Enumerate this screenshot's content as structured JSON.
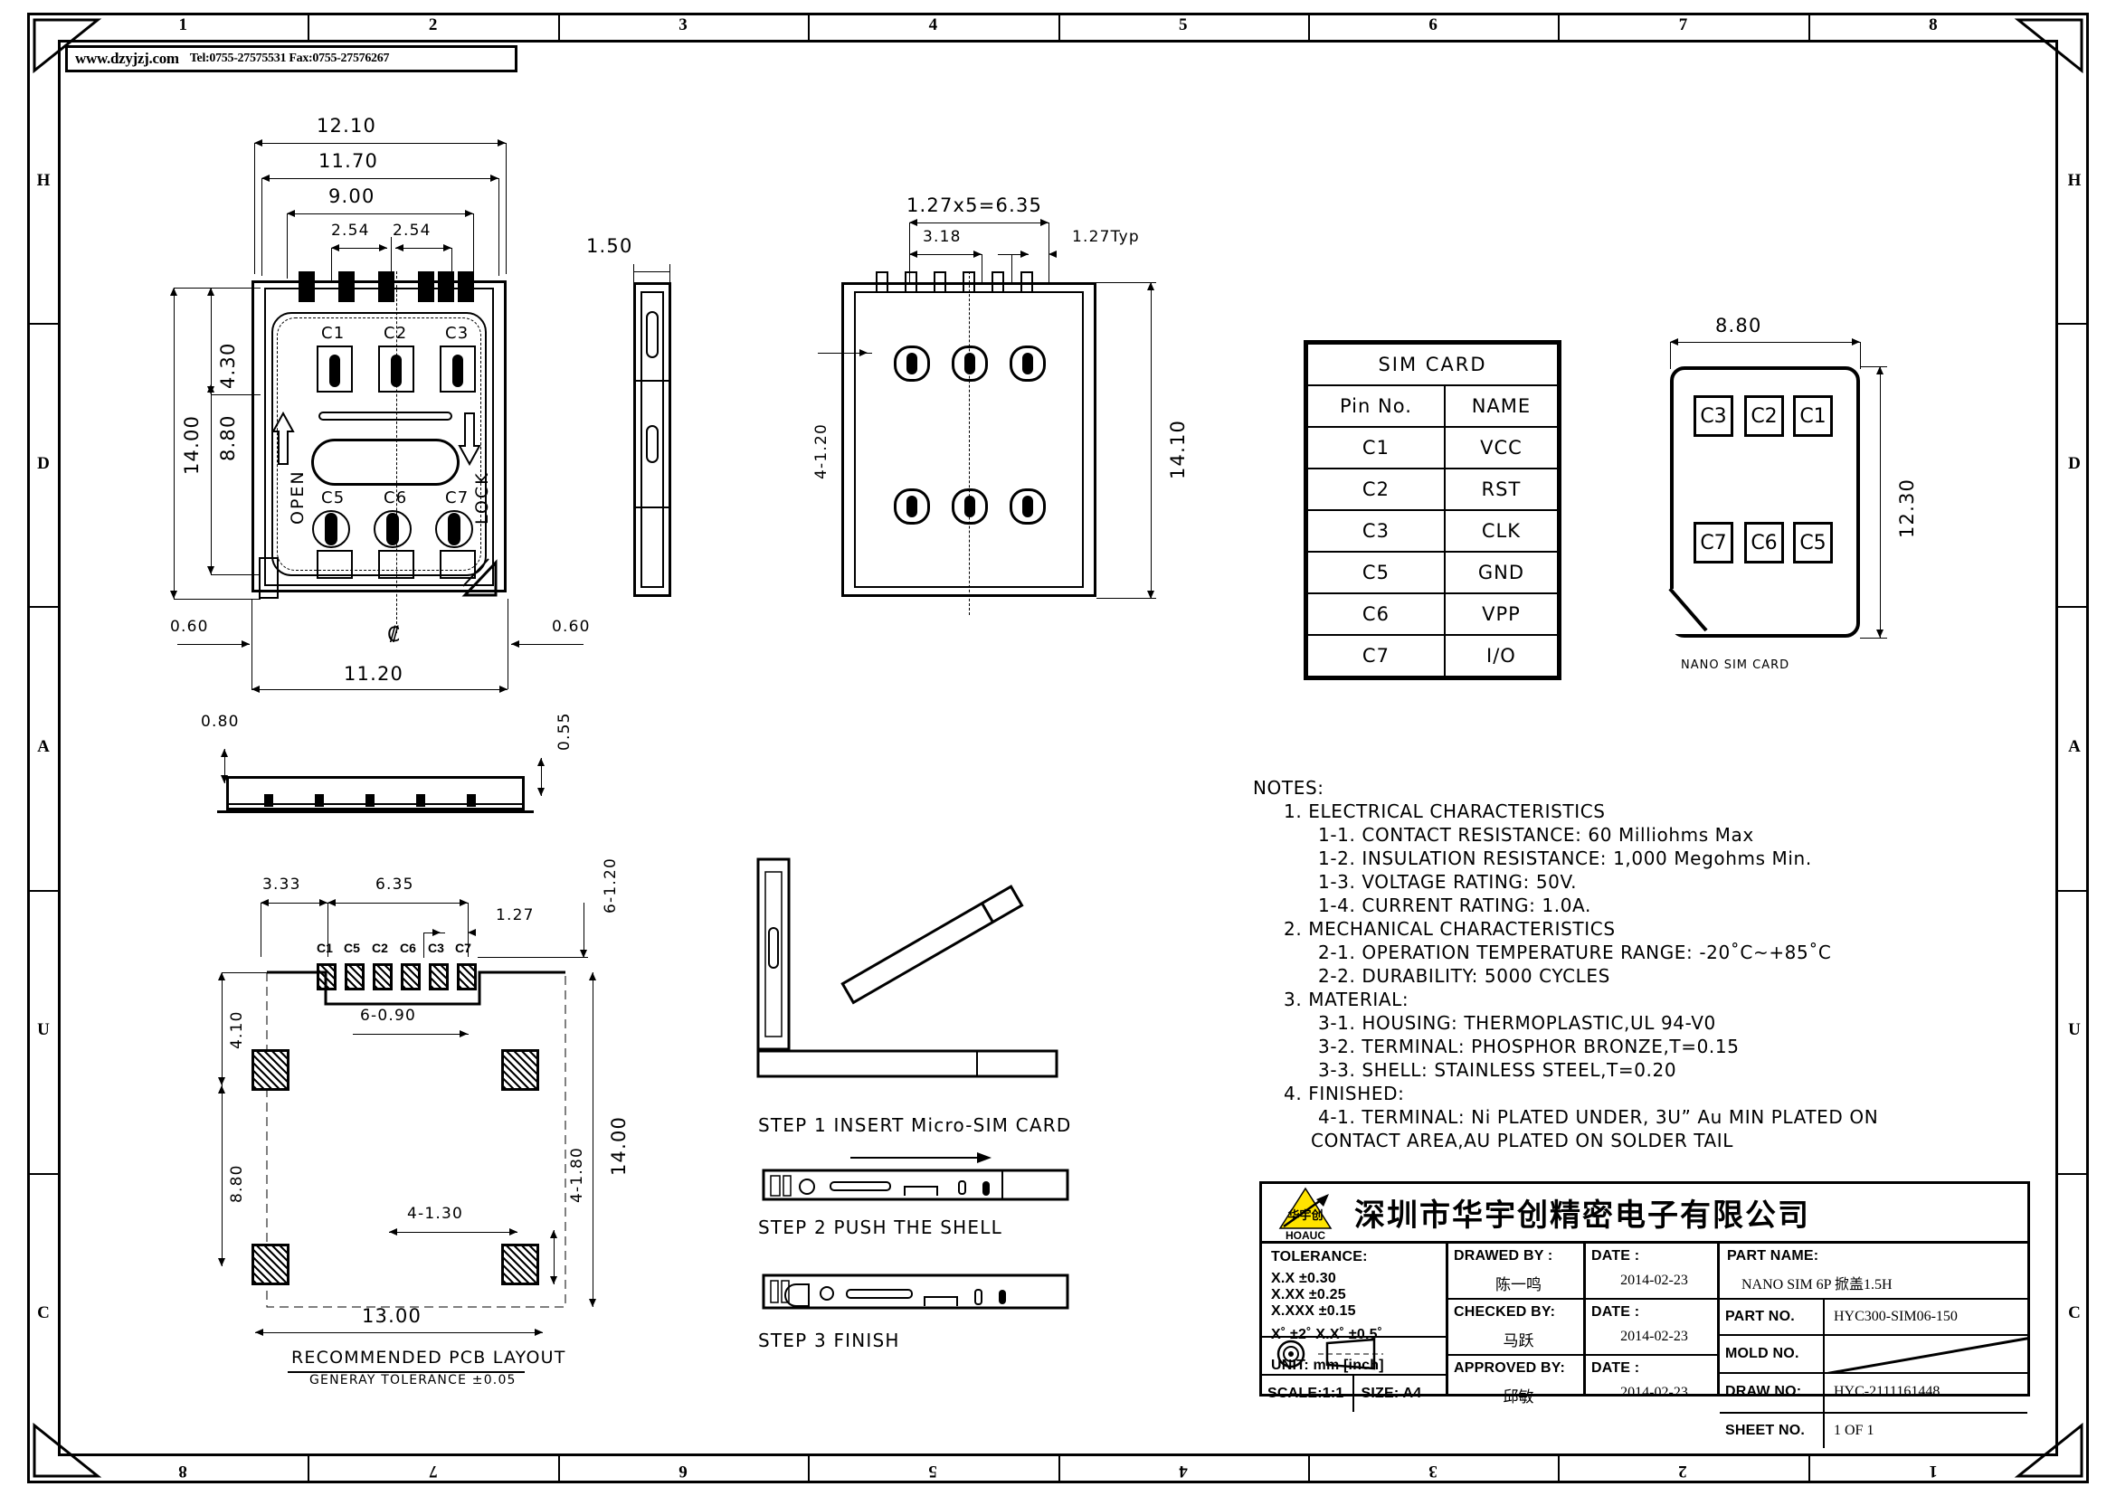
{
  "header": {
    "url": "www.dzyjzj.com",
    "contact": "Tel:0755-27575531  Fax:0755-27576267"
  },
  "zones": {
    "top": [
      "1",
      "2",
      "3",
      "4",
      "5",
      "6",
      "7",
      "8"
    ],
    "bottom": [
      "8",
      "7",
      "6",
      "5",
      "4",
      "3",
      "2",
      "1"
    ],
    "left": [
      "H",
      "D",
      "A",
      "U",
      "C"
    ],
    "right": [
      "H",
      "D",
      "A",
      "U",
      "C"
    ]
  },
  "views": {
    "top_view": {
      "dims": {
        "d1210": "12.10",
        "d1170": "11.70",
        "d900": "9.00",
        "d254a": "2.54",
        "d254b": "2.54",
        "d430": "4.30",
        "d1400": "14.00",
        "d880": "8.80",
        "d060_left": "0.60",
        "d060_right": "0.60",
        "d1120": "11.20"
      },
      "pins_top": [
        "C1",
        "C2",
        "C3"
      ],
      "pins_bottom": [
        "C5",
        "C6",
        "C7"
      ],
      "open_label": "OPEN",
      "lock_label": "LOCK",
      "center_symbol": "₡"
    },
    "side_view": {
      "d150": "1.50"
    },
    "bottom_view": {
      "d127x5": "1.27x5=6.35",
      "d318": "3.18",
      "d127typ": "1.27Typ",
      "d1410": "14.10",
      "d4_120": "4-1.20"
    },
    "front_view": {
      "d080": "0.80",
      "d055": "0.55"
    },
    "pcb_layout": {
      "title": "RECOMMENDED PCB LAYOUT",
      "subtitle": "GENERAY TOLERANCE ±0.05",
      "dims": {
        "d333": "3.33",
        "d635": "6.35",
        "d127": "1.27",
        "d6_120": "6-1.20",
        "d410": "4.10",
        "d6_090": "6-0.90",
        "d880": "8.80",
        "d1400": "14.00",
        "d4_130": "4-1.30",
        "d4_180": "4-1.80",
        "d1300": "13.00"
      },
      "pad_labels": [
        "C1",
        "C5",
        "C2",
        "C6",
        "C3",
        "C7"
      ]
    },
    "steps": [
      "STEP 1  INSERT Micro-SIM CARD",
      "STEP 2   PUSH THE SHELL",
      "STEP 3   FINISH"
    ]
  },
  "pin_table": {
    "title": "SIM  CARD",
    "headers": [
      "Pin No.",
      "NAME"
    ],
    "rows": [
      [
        "C1",
        "VCC"
      ],
      [
        "C2",
        "RST"
      ],
      [
        "C3",
        "CLK"
      ],
      [
        "C5",
        "GND"
      ],
      [
        "C6",
        "VPP"
      ],
      [
        "C7",
        "I/O"
      ]
    ]
  },
  "nano_sim": {
    "caption": "NANO SIM CARD",
    "width_dim": "8.80",
    "height_dim": "12.30",
    "pads_top": [
      "C3",
      "C2",
      "C1"
    ],
    "pads_bottom": [
      "C7",
      "C6",
      "C5"
    ]
  },
  "notes": {
    "title": "NOTES:",
    "lines": [
      {
        "indent": 1,
        "text": "1. ELECTRICAL CHARACTERISTICS"
      },
      {
        "indent": 2,
        "text": "1-1. CONTACT RESISTANCE: 60 Milliohms   Max"
      },
      {
        "indent": 2,
        "text": "1-2. INSULATION RESISTANCE: 1,000 Megohms Min."
      },
      {
        "indent": 2,
        "text": "1-3. VOLTAGE RATING: 50V."
      },
      {
        "indent": 2,
        "text": "1-4. CURRENT RATING: 1.0A."
      },
      {
        "indent": 1,
        "text": "2. MECHANICAL CHARACTERISTICS"
      },
      {
        "indent": 2,
        "text": "2-1. OPERATION TEMPERATURE RANGE: -20˚C~+85˚C"
      },
      {
        "indent": 2,
        "text": "2-2. DURABILITY: 5000 CYCLES"
      },
      {
        "indent": 1,
        "text": "3. MATERIAL:"
      },
      {
        "indent": 2,
        "text": "3-1. HOUSING: THERMOPLASTIC,UL 94-V0"
      },
      {
        "indent": 2,
        "text": "3-2. TERMINAL: PHOSPHOR BRONZE,T=0.15"
      },
      {
        "indent": 2,
        "text": "3-3. SHELL: STAINLESS STEEL,T=0.20"
      },
      {
        "indent": 1,
        "text": "4. FINISHED:"
      },
      {
        "indent": 2,
        "text": "4-1. TERMINAL: Ni PLATED UNDER, 3U” Au MIN PLATED ON"
      },
      {
        "indent": 3,
        "text": "CONTACT AREA,AU PLATED ON SOLDER TAIL"
      }
    ]
  },
  "title_block": {
    "company_cn": "深圳市华宇创精密电子有限公司",
    "logo_text": "HOAUC",
    "tolerance": {
      "label": "TOLERANCE:",
      "rows": [
        "X.X    ±0.30",
        "X.XX  ±0.25",
        "X.XXX ±0.15"
      ],
      "angular": "X˚ ±2˚      X.X˚ ±0.5˚"
    },
    "unit": "UNIT: mm [inch]",
    "scale": "SCALE:1:1",
    "size": "SIZE: A4",
    "drawed_by_label": "DRAWED BY :",
    "drawed_by": "陈一鸣",
    "drawed_date_label": "DATE :",
    "drawed_date": "2014-02-23",
    "checked_by_label": "CHECKED BY:",
    "checked_by": "马跃",
    "checked_date_label": "DATE :",
    "checked_date": "2014-02-23",
    "approved_by_label": "APPROVED BY:",
    "approved_by": "邱敏",
    "approved_date_label": "DATE :",
    "approved_date": "2014-02-23",
    "part_name_label": "PART NAME:",
    "part_name": "NANO SIM 6P 掀盖1.5H",
    "part_no_label": "PART NO.",
    "part_no": "HYC300-SIM06-150",
    "mold_no_label": "MOLD NO.",
    "mold_no": "",
    "draw_no_label": "DRAW NO:",
    "draw_no": "HYC-2111161448",
    "sheet_no_label": "SHEET NO.",
    "sheet_no": "1 OF 1"
  },
  "colors": {
    "ink": "#000000",
    "paper": "#ffffff",
    "logo_yellow": "#ffe400"
  }
}
